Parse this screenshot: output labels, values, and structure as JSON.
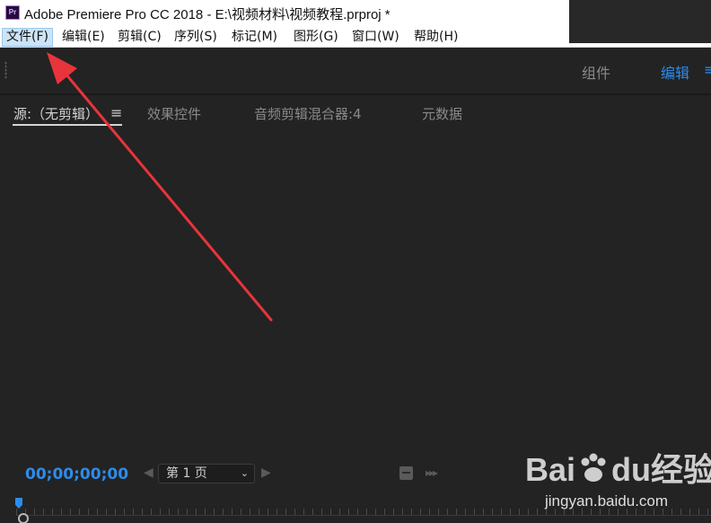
{
  "window": {
    "app_logo_text": "Pr",
    "title": "Adobe Premiere Pro CC 2018 - E:\\视频材料\\视频教程.prproj *"
  },
  "menu": {
    "items": [
      "文件(F)",
      "编辑(E)",
      "剪辑(C)",
      "序列(S)",
      "标记(M)",
      "图形(G)",
      "窗口(W)",
      "帮助(H)"
    ],
    "active_index": 0
  },
  "workspaces": {
    "tabs": [
      "组件",
      "编辑"
    ],
    "active": "编辑",
    "menu_icon": "hamburger-icon"
  },
  "panel_tabs": {
    "source": "源:（无剪辑）",
    "effect_controls": "效果控件",
    "audio_mixer": "音频剪辑混合器:4",
    "metadata": "元数据",
    "menu_icon": "hamburger-icon"
  },
  "controls": {
    "timecode": "00;00;00;00",
    "page_select": "第 1 页",
    "icons": [
      "chevron-left-icon",
      "chevron-down-icon",
      "chevron-right-icon",
      "insert-icon",
      "overwrite-icon"
    ]
  },
  "colors": {
    "accent": "#2d8ceb",
    "panel_bg": "#232323",
    "annotation_arrow": "#e8343b"
  },
  "watermark": {
    "brand_a": "Bai",
    "brand_b": "du",
    "brand_c": "经验",
    "site": "jingyan.baidu.com"
  }
}
